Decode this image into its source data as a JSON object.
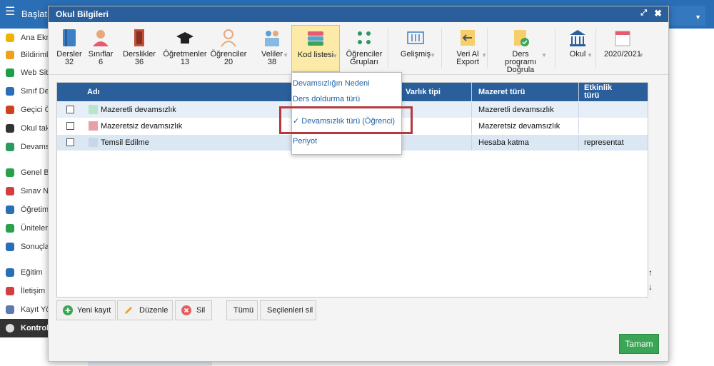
{
  "topbar": {
    "start_label": "Başlat"
  },
  "sidebar": {
    "items": [
      {
        "label": "Ana Ekran",
        "icon": "star-icon",
        "color": "#f0b400"
      },
      {
        "label": "Bildirimler",
        "icon": "mail-icon",
        "color": "#f0a020"
      },
      {
        "label": "Web Sitesi",
        "icon": "home-icon",
        "color": "#1e9e4a"
      },
      {
        "label": "Sınıf Defteri",
        "icon": "book-icon",
        "color": "#2a6fb6"
      },
      {
        "label": "Geçici Öğrenci",
        "icon": "person-icon",
        "color": "#d04020"
      },
      {
        "label": "Okul takvimi",
        "icon": "calendar-icon",
        "color": "#333333"
      },
      {
        "label": "Devamsızlık",
        "icon": "user-icon",
        "color": "#2a9a60"
      },
      {
        "label": "Genel Bilgiler",
        "icon": "check-icon",
        "color": "#2aa04a"
      },
      {
        "label": "Sınav Notları",
        "icon": "exam-icon",
        "color": "#d04040"
      },
      {
        "label": "Öğretim",
        "icon": "briefcase-icon",
        "color": "#2a6fb6"
      },
      {
        "label": "Üniteler",
        "icon": "shield-icon",
        "color": "#2aa04a"
      },
      {
        "label": "Sonuçlar",
        "icon": "bar-chart-icon",
        "color": "#2a6fb6"
      },
      {
        "label": "Eğitim",
        "icon": "education-icon",
        "color": "#2a6fb6"
      },
      {
        "label": "İletişim",
        "icon": "chat-icon",
        "color": "#d04040"
      },
      {
        "label": "Kayıt Yönetimi",
        "icon": "pen-icon",
        "color": "#5a7ab0"
      },
      {
        "label": "Kontrol",
        "icon": "gear-icon",
        "color": "#333333"
      }
    ]
  },
  "dialog": {
    "title": "Okul Bilgileri"
  },
  "toolbar": {
    "items": [
      {
        "label": "Dersler",
        "count": "32",
        "icon": "book-icon",
        "color": "#3b7fc4",
        "caret": false
      },
      {
        "label": "Sınıflar",
        "count": "6",
        "icon": "users-icon",
        "color": "#e8a87c",
        "caret": false
      },
      {
        "label": "Derslikler",
        "count": "36",
        "icon": "door-icon",
        "color": "#c0503a",
        "caret": false
      },
      {
        "label": "Öğretmenler",
        "count": "13",
        "icon": "graduation-cap-icon",
        "color": "#222222",
        "caret": false
      },
      {
        "label": "Öğrenciler",
        "count": "20",
        "icon": "student-icon",
        "color": "#e8a87c",
        "caret": true
      },
      {
        "label": "Veliler",
        "count": "38",
        "icon": "parents-icon",
        "color": "#5aa0d8",
        "caret": true
      },
      {
        "label": "Kod listesi",
        "count": "",
        "icon": "layers-icon",
        "color": "#e85a70",
        "caret": true
      },
      {
        "label": "Öğrenciler Grupları",
        "count": "",
        "icon": "group-icon",
        "color": "#2a9a60",
        "caret": false
      },
      {
        "label": "Gelişmiş",
        "count": "",
        "icon": "sliders-icon",
        "color": "#3b7fc4",
        "caret": true
      },
      {
        "label": "Veri Al Export",
        "count": "",
        "icon": "import-icon",
        "color": "#f0a020",
        "caret": true
      },
      {
        "label": "Ders programı Doğrula",
        "count": "",
        "icon": "schedule-check-icon",
        "color": "#f0a020",
        "caret": true
      },
      {
        "label": "Okul",
        "count": "",
        "icon": "school-icon",
        "color": "#2a5f9c",
        "caret": true
      },
      {
        "label": "2020/2021",
        "count": "",
        "icon": "calendar-icon",
        "color": "#e85a70",
        "caret": true
      }
    ]
  },
  "grid": {
    "columns": [
      "Adı",
      "Varlık tipi",
      "Mazeret türü",
      "Etkinlik türü"
    ],
    "rows": [
      {
        "name": "Mazeretli devamsızlık",
        "swatch": "#b8e6c8",
        "entity": "",
        "excuse": "Mazeretli devamsızlık",
        "activity": ""
      },
      {
        "name": "Mazeretsiz devamsızlık",
        "swatch": "#e8a0a8",
        "entity": "",
        "excuse": "Mazeretsiz devamsızlık",
        "activity": ""
      },
      {
        "name": "Temsil Edilme",
        "swatch": "#c8d8e8",
        "entity": "",
        "excuse": "Hesaba katma",
        "activity": "representat"
      }
    ]
  },
  "dropdown": {
    "items": [
      {
        "label": "Devamsızlığın Nedeni",
        "checked": false
      },
      {
        "label": "Ders doldurma türü",
        "checked": false
      },
      {
        "label": "✓ Devamsızlık türü (Öğrenci)",
        "checked": true
      },
      {
        "label": "Periyot",
        "checked": false
      }
    ]
  },
  "buttons": {
    "new": "Yeni kayıt",
    "edit": "Düzenle",
    "delete": "Sil",
    "all": "Tümü",
    "delete_selected": "Seçilenleri sil",
    "ok": "Tamam"
  },
  "colors": {
    "header": "#2a5f9c",
    "accent_green": "#3aa655",
    "highlight_red": "#b3393d"
  }
}
